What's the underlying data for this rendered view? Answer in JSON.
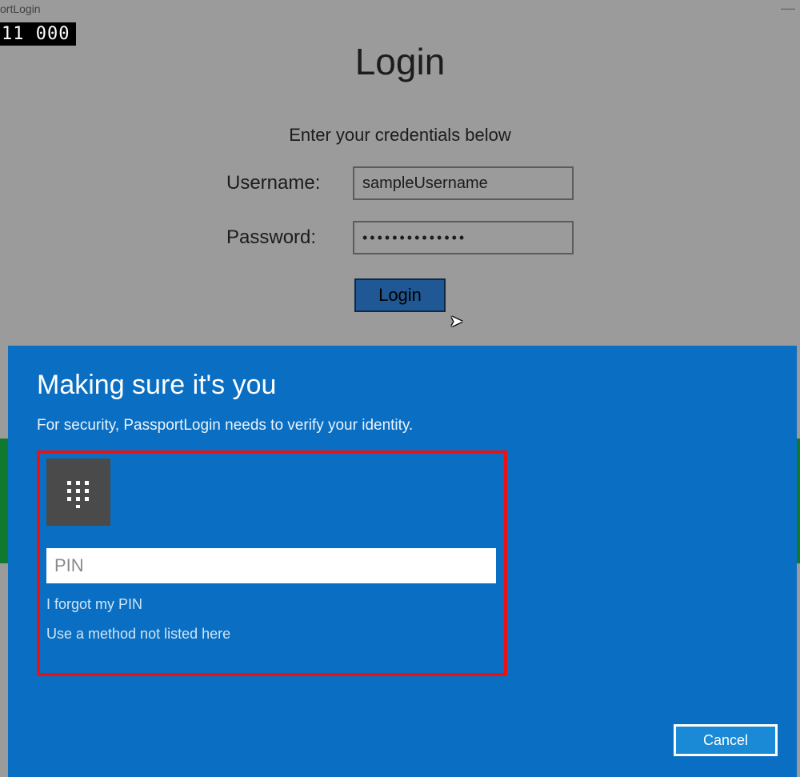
{
  "window": {
    "title_fragment": "ortLogin",
    "minimize": "—"
  },
  "badge": "11  000",
  "login": {
    "title": "Login",
    "subtitle": "Enter your credentials below",
    "username_label": "Username:",
    "username_value": "sampleUsername",
    "password_label": "Password:",
    "password_value": "••••••••••••••",
    "button": "Login"
  },
  "modal": {
    "title": "Making sure it's you",
    "subtitle": "For security, PassportLogin needs to verify your identity.",
    "pin_placeholder": "PIN",
    "forgot_link": "I forgot my PIN",
    "alt_method_link": "Use a method not listed here",
    "cancel": "Cancel"
  }
}
